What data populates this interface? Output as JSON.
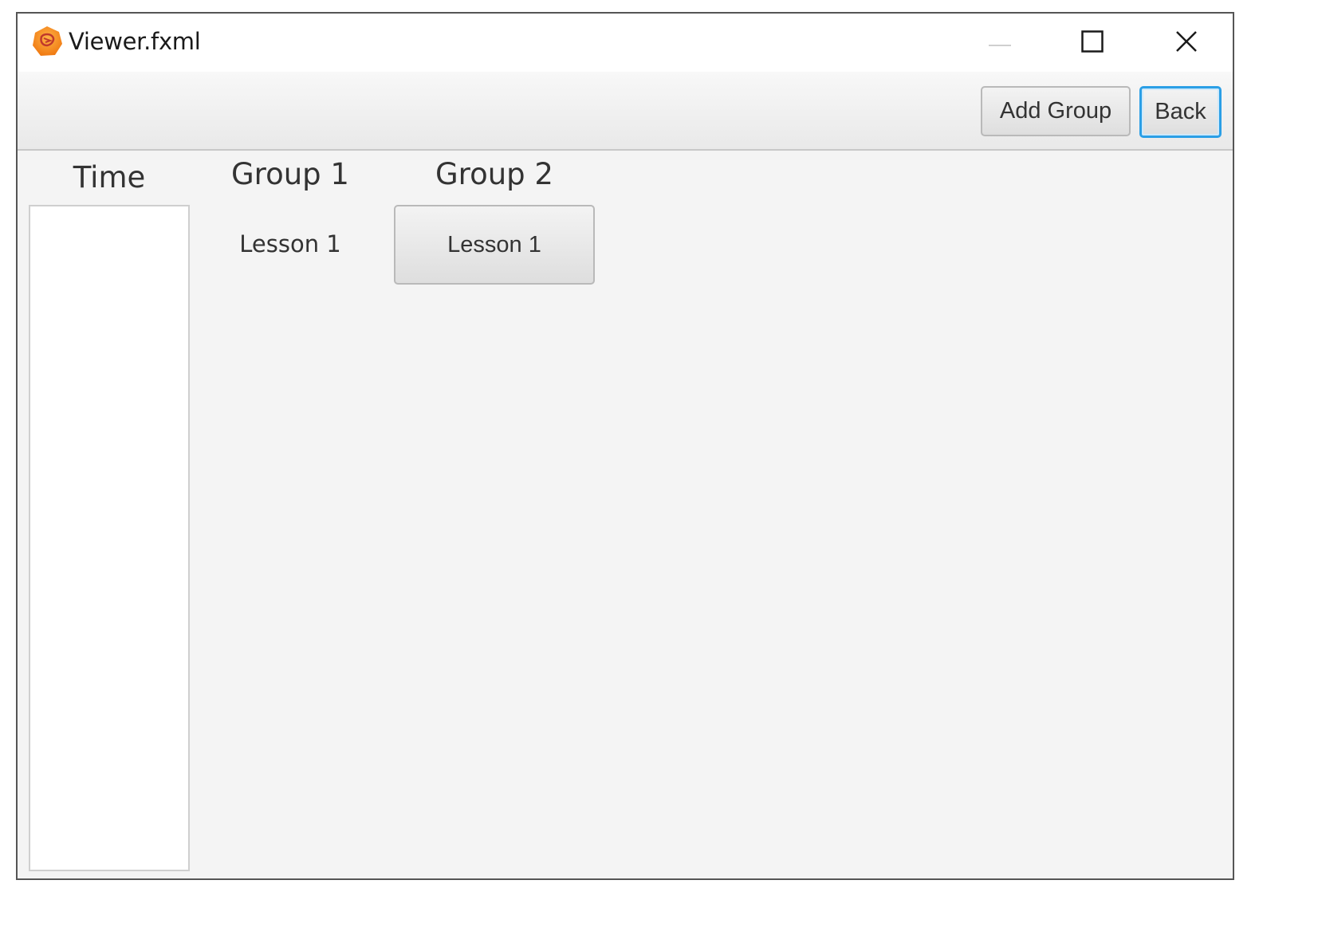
{
  "window": {
    "title": "Viewer.fxml",
    "icon": "javafx-app-icon",
    "controls": {
      "minimize": "minimize-icon",
      "maximize": "maximize-icon",
      "close": "close-icon"
    }
  },
  "toolbar": {
    "add_group_label": "Add Group",
    "back_label": "Back"
  },
  "schedule": {
    "time_header": "Time",
    "groups": [
      {
        "name": "Group 1",
        "lessons": [
          "Lesson 1"
        ]
      },
      {
        "name": "Group 2",
        "lessons": [
          "Lesson 1"
        ]
      }
    ]
  },
  "colors": {
    "accent_focus": "#2b9fe6",
    "background": "#f4f4f4"
  }
}
